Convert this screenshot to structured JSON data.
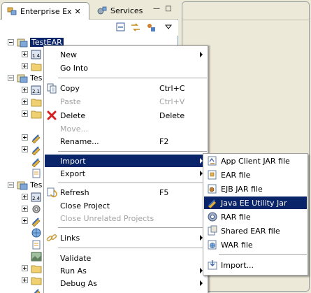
{
  "view": {
    "active_tab": "Enterprise Ex",
    "inactive_tab": "Services",
    "close_glyph": "✕",
    "minimize_glyph": "—",
    "maximize_glyph": "□"
  },
  "tree": {
    "rows": [
      {
        "label": "TestEAR",
        "selected": true,
        "expanded": true
      },
      {
        "label": "",
        "icon": "ear-lib-1-4-icon"
      },
      {
        "label": "",
        "icon": "folder-icon"
      },
      {
        "label": "Tes",
        "expanded": true
      },
      {
        "label": "",
        "icon": "ejb-2-1-icon"
      },
      {
        "label": "",
        "icon": "folder-icon"
      },
      {
        "label": "",
        "icon": "folder-icon"
      },
      {
        "label": "",
        "icon": "jar-icon"
      },
      {
        "label": "",
        "icon": "jar-icon"
      },
      {
        "label": "",
        "icon": "jar-icon"
      },
      {
        "label": "",
        "icon": "file-icon"
      },
      {
        "label": "Tes",
        "expanded": true
      },
      {
        "label": "",
        "icon": "web-2-4-icon"
      },
      {
        "label": "",
        "icon": "gear-icon"
      },
      {
        "label": "",
        "icon": "jar-icon"
      },
      {
        "label": "",
        "icon": "globe-icon"
      },
      {
        "label": "",
        "icon": "file-icon"
      },
      {
        "label": "",
        "icon": "image-icon"
      },
      {
        "label": "",
        "icon": "folder-icon"
      },
      {
        "label": "",
        "icon": "folder-icon"
      },
      {
        "label": "",
        "icon": "jar-icon"
      }
    ]
  },
  "context_menu": {
    "new": "New",
    "go_into": "Go Into",
    "copy": "Copy",
    "copy_accel": "Ctrl+C",
    "paste": "Paste",
    "paste_accel": "Ctrl+V",
    "delete": "Delete",
    "delete_accel": "Delete",
    "move": "Move...",
    "rename": "Rename...",
    "rename_accel": "F2",
    "import": "Import",
    "export": "Export",
    "refresh": "Refresh",
    "refresh_accel": "F5",
    "close_project": "Close Project",
    "close_unrelated": "Close Unrelated Projects",
    "links": "Links",
    "validate": "Validate",
    "run_as": "Run As",
    "debug_as": "Debug As"
  },
  "import_submenu": {
    "items": [
      "App Client JAR file",
      "EAR file",
      "EJB JAR file",
      "Java EE Utility Jar",
      "RAR file",
      "Shared EAR file",
      "WAR file"
    ],
    "more": "Import..."
  },
  "colors": {
    "selection": "#0a246a",
    "menu_bg": "#ffffff",
    "disabled_text": "#a3a3a3",
    "delete_icon": "#d42020"
  }
}
